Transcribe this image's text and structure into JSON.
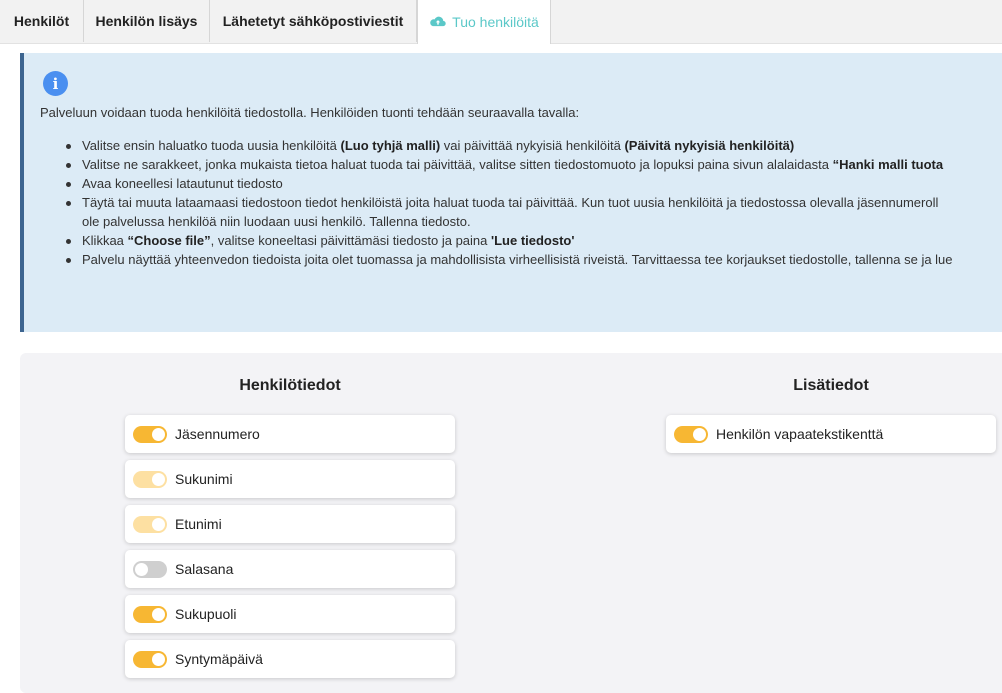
{
  "tabs": [
    {
      "label": "Henkilöt"
    },
    {
      "label": "Henkilön lisäys"
    },
    {
      "label": "Lähetetyt sähköpostiviestit"
    },
    {
      "label": "Tuo henkilöitä",
      "icon": "cloud-upload-icon",
      "active": true
    }
  ],
  "info": {
    "icon": "info-icon",
    "intro": "Palveluun voidaan tuoda henkilöitä tiedostolla. Henkilöiden tuonti tehdään seuraavalla tavalla:",
    "steps": [
      {
        "parts": [
          {
            "t": "Valitse ensin haluatko tuoda uusia henkilöitä "
          },
          {
            "t": "(Luo tyhjä malli)",
            "b": true
          },
          {
            "t": " vai päivittää nykyisiä henkilöitä "
          },
          {
            "t": "(Päivitä nykyisiä henkilöitä)",
            "b": true
          }
        ]
      },
      {
        "parts": [
          {
            "t": "Valitse ne sarakkeet, jonka mukaista tietoa haluat tuoda tai päivittää, valitse sitten tiedostomuoto ja lopuksi paina sivun alalaidasta "
          },
          {
            "t": "“Hanki malli tuota",
            "b": true
          }
        ]
      },
      {
        "parts": [
          {
            "t": "Avaa koneellesi latautunut tiedosto"
          }
        ]
      },
      {
        "parts": [
          {
            "t": "Täytä tai muuta lataamaasi tiedostoon tiedot henkilöistä joita haluat tuoda tai päivittää. Kun tuot uusia henkilöitä ja tiedostossa olevalla jäsennumeroll"
          }
        ]
      },
      {
        "parts": [
          {
            "t": "ole palvelussa henkilöä niin luodaan uusi henkilö. Tallenna tiedosto."
          }
        ],
        "continuation": true
      },
      {
        "parts": [
          {
            "t": "Klikkaa "
          },
          {
            "t": "“Choose file”",
            "b": true
          },
          {
            "t": ", valitse koneeltasi päivittämäsi tiedosto ja paina "
          },
          {
            "t": "'Lue tiedosto'",
            "b": true
          }
        ]
      },
      {
        "parts": [
          {
            "t": "Palvelu näyttää yhteenvedon tiedoista joita olet tuomassa ja mahdollisista virheellisistä riveistä. Tarvittaessa tee korjaukset tiedostolle, tallenna se ja lue"
          }
        ]
      }
    ]
  },
  "columns": {
    "personal": {
      "title": "Henkilötiedot",
      "fields": [
        {
          "label": "Jäsennumero",
          "state": "on"
        },
        {
          "label": "Sukunimi",
          "state": "on-dim"
        },
        {
          "label": "Etunimi",
          "state": "on-dim"
        },
        {
          "label": "Salasana",
          "state": "off"
        },
        {
          "label": "Sukupuoli",
          "state": "on"
        },
        {
          "label": "Syntymäpäivä",
          "state": "on"
        }
      ]
    },
    "extra": {
      "title": "Lisätiedot",
      "fields": [
        {
          "label": "Henkilön vapaatekstikenttä",
          "state": "on"
        }
      ]
    }
  },
  "colors": {
    "accent": "#f7b733",
    "accent_dim": "#fde0a2",
    "toggle_off": "#cfcfcf",
    "info_bg": "#dcebf6",
    "info_border": "#3d6590",
    "active_tab": "#5bc8c8"
  }
}
